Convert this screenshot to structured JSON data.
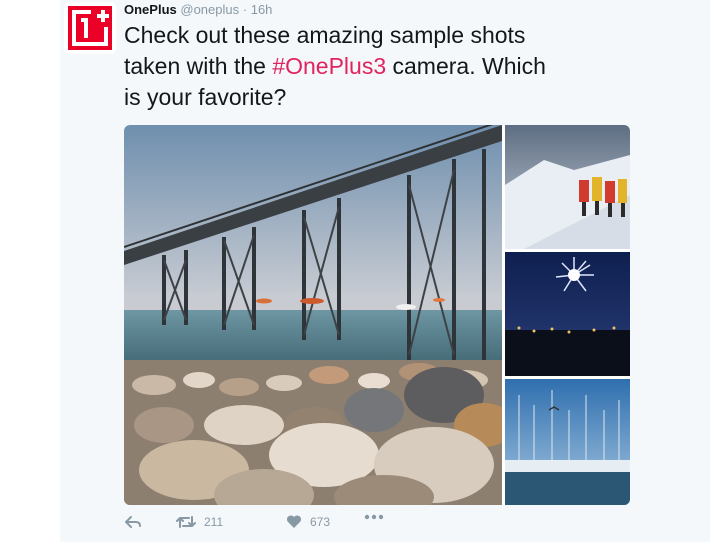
{
  "tweet": {
    "display_name": "OnePlus",
    "handle": "@oneplus",
    "separator": "·",
    "time": "16h",
    "text_line1": "Check out these amazing sample shots",
    "text_line2_prefix": "taken with the ",
    "hashtag": "#OnePlus3",
    "text_line2_suffix": " camera. Which",
    "text_line3": "is your favorite?"
  },
  "avatar": {
    "logo_text": "1+",
    "brand_color": "#eb0028"
  },
  "media": {
    "images": [
      "pier-on-pebble-beach",
      "climbers-on-snowy-mountain",
      "fireworks-over-city",
      "marina-with-sailboats"
    ]
  },
  "actions": {
    "retweet_count": "211",
    "like_count": "673"
  },
  "colors": {
    "hashtag": "#e0245e",
    "muted": "#8899a6",
    "text": "#14171a",
    "background": "#f5f8fa"
  }
}
